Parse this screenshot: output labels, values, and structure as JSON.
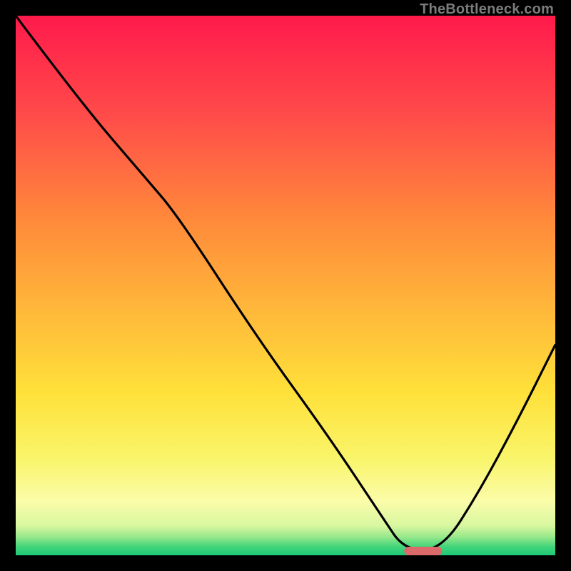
{
  "watermark": "TheBottleneck.com",
  "chart_data": {
    "type": "line",
    "title": "",
    "xlabel": "",
    "ylabel": "",
    "optimal_zone": {
      "x_start_frac": 0.72,
      "x_end_frac": 0.79
    },
    "curve_points_frac": [
      {
        "x": 0.0,
        "y": 1.0
      },
      {
        "x": 0.12,
        "y": 0.84
      },
      {
        "x": 0.24,
        "y": 0.7
      },
      {
        "x": 0.3,
        "y": 0.63
      },
      {
        "x": 0.45,
        "y": 0.4
      },
      {
        "x": 0.58,
        "y": 0.22
      },
      {
        "x": 0.68,
        "y": 0.07
      },
      {
        "x": 0.72,
        "y": 0.01
      },
      {
        "x": 0.79,
        "y": 0.01
      },
      {
        "x": 0.86,
        "y": 0.12
      },
      {
        "x": 0.93,
        "y": 0.25
      },
      {
        "x": 1.0,
        "y": 0.39
      }
    ],
    "gradient_stops": [
      {
        "offset": 0.0,
        "color": "#ff1a4b"
      },
      {
        "offset": 0.18,
        "color": "#ff4a4a"
      },
      {
        "offset": 0.38,
        "color": "#ff8a3a"
      },
      {
        "offset": 0.55,
        "color": "#ffb93a"
      },
      {
        "offset": 0.7,
        "color": "#ffe13a"
      },
      {
        "offset": 0.82,
        "color": "#f9f56a"
      },
      {
        "offset": 0.9,
        "color": "#fbfca9"
      },
      {
        "offset": 0.945,
        "color": "#d8f7a0"
      },
      {
        "offset": 0.965,
        "color": "#9be98c"
      },
      {
        "offset": 0.985,
        "color": "#3fd47a"
      },
      {
        "offset": 1.0,
        "color": "#1fc877"
      }
    ],
    "marker_color": "#dd6a6a"
  }
}
